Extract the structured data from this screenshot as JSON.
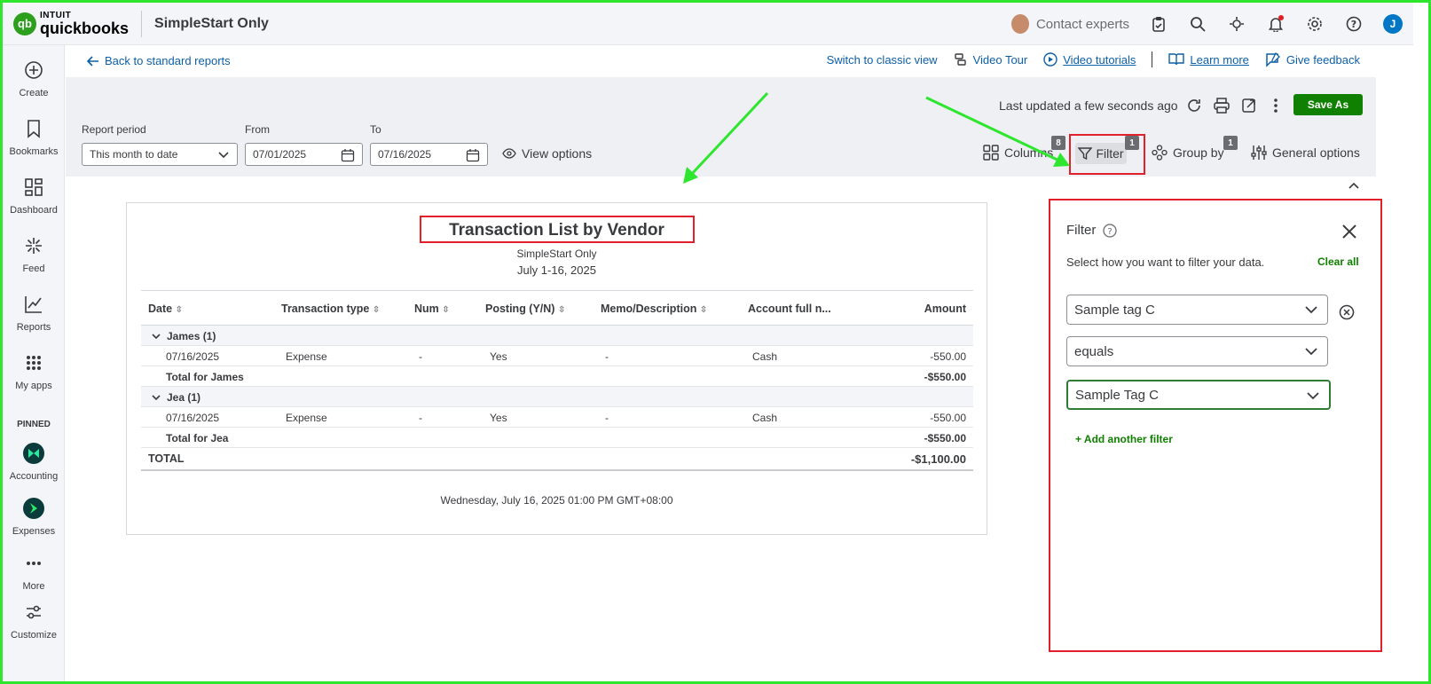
{
  "brand": {
    "intuit": "INTUIT",
    "product": "quickbooks",
    "logo_glyph": "qb"
  },
  "topbar": {
    "company": "SimpleStart Only",
    "contact": "Contact experts",
    "user_initial": "J"
  },
  "nav": {
    "items": [
      {
        "label": "Create",
        "icon": "plus-circle-icon"
      },
      {
        "label": "Bookmarks",
        "icon": "bookmark-icon"
      },
      {
        "label": "Dashboard",
        "icon": "dashboard-icon"
      },
      {
        "label": "Feed",
        "icon": "feed-icon"
      },
      {
        "label": "Reports",
        "icon": "reports-icon"
      },
      {
        "label": "My apps",
        "icon": "apps-grid-icon"
      }
    ],
    "pinned_label": "PINNED",
    "pinned": [
      {
        "label": "Accounting",
        "icon": "accounting-icon"
      },
      {
        "label": "Expenses",
        "icon": "expenses-icon"
      }
    ],
    "more": "More",
    "customize": "Customize"
  },
  "header": {
    "back": "Back to standard reports",
    "switch_view": "Switch to classic view",
    "video_tour": "Video Tour",
    "video_tutorials": "Video tutorials",
    "learn_more": "Learn more",
    "feedback": "Give feedback"
  },
  "controls": {
    "last_updated": "Last updated a few seconds ago",
    "save_as": "Save As",
    "report_period_label": "Report period",
    "report_period": "This month to date",
    "from_label": "From",
    "from": "07/01/2025",
    "to_label": "To",
    "to": "07/16/2025",
    "view_options": "View options",
    "columns": "Columns",
    "columns_badge": "8",
    "filter": "Filter",
    "filter_badge": "1",
    "group_by": "Group by",
    "group_by_badge": "1",
    "general_options": "General options"
  },
  "report": {
    "title": "Transaction List by Vendor",
    "company": "SimpleStart Only",
    "period": "July 1-16, 2025",
    "columns": [
      "Date",
      "Transaction type",
      "Num",
      "Posting (Y/N)",
      "Memo/Description",
      "Account full n...",
      "Amount"
    ],
    "groups": [
      {
        "name": "James (1)",
        "rows": [
          [
            "07/16/2025",
            "Expense",
            "-",
            "Yes",
            "-",
            "Cash",
            "-550.00"
          ]
        ],
        "total_label": "Total for James",
        "total": "-$550.00"
      },
      {
        "name": "Jea (1)",
        "rows": [
          [
            "07/16/2025",
            "Expense",
            "-",
            "Yes",
            "-",
            "Cash",
            "-550.00"
          ]
        ],
        "total_label": "Total for Jea",
        "total": "-$550.00"
      }
    ],
    "grand_total_label": "TOTAL",
    "grand_total": "-$1,100.00",
    "footer": "Wednesday, July 16, 2025 01:00 PM GMT+08:00"
  },
  "filter_panel": {
    "title": "Filter",
    "description": "Select how you want to filter your data.",
    "clear_all": "Clear all",
    "field": "Sample tag C",
    "operator": "equals",
    "value": "Sample Tag C",
    "add_filter": "+ Add another filter"
  },
  "colors": {
    "brand_green": "#2ca01c",
    "action_green": "#108000",
    "link_blue": "#0d5fa6",
    "annotation_red": "#e0202a",
    "annotation_green": "#2ee62e"
  }
}
